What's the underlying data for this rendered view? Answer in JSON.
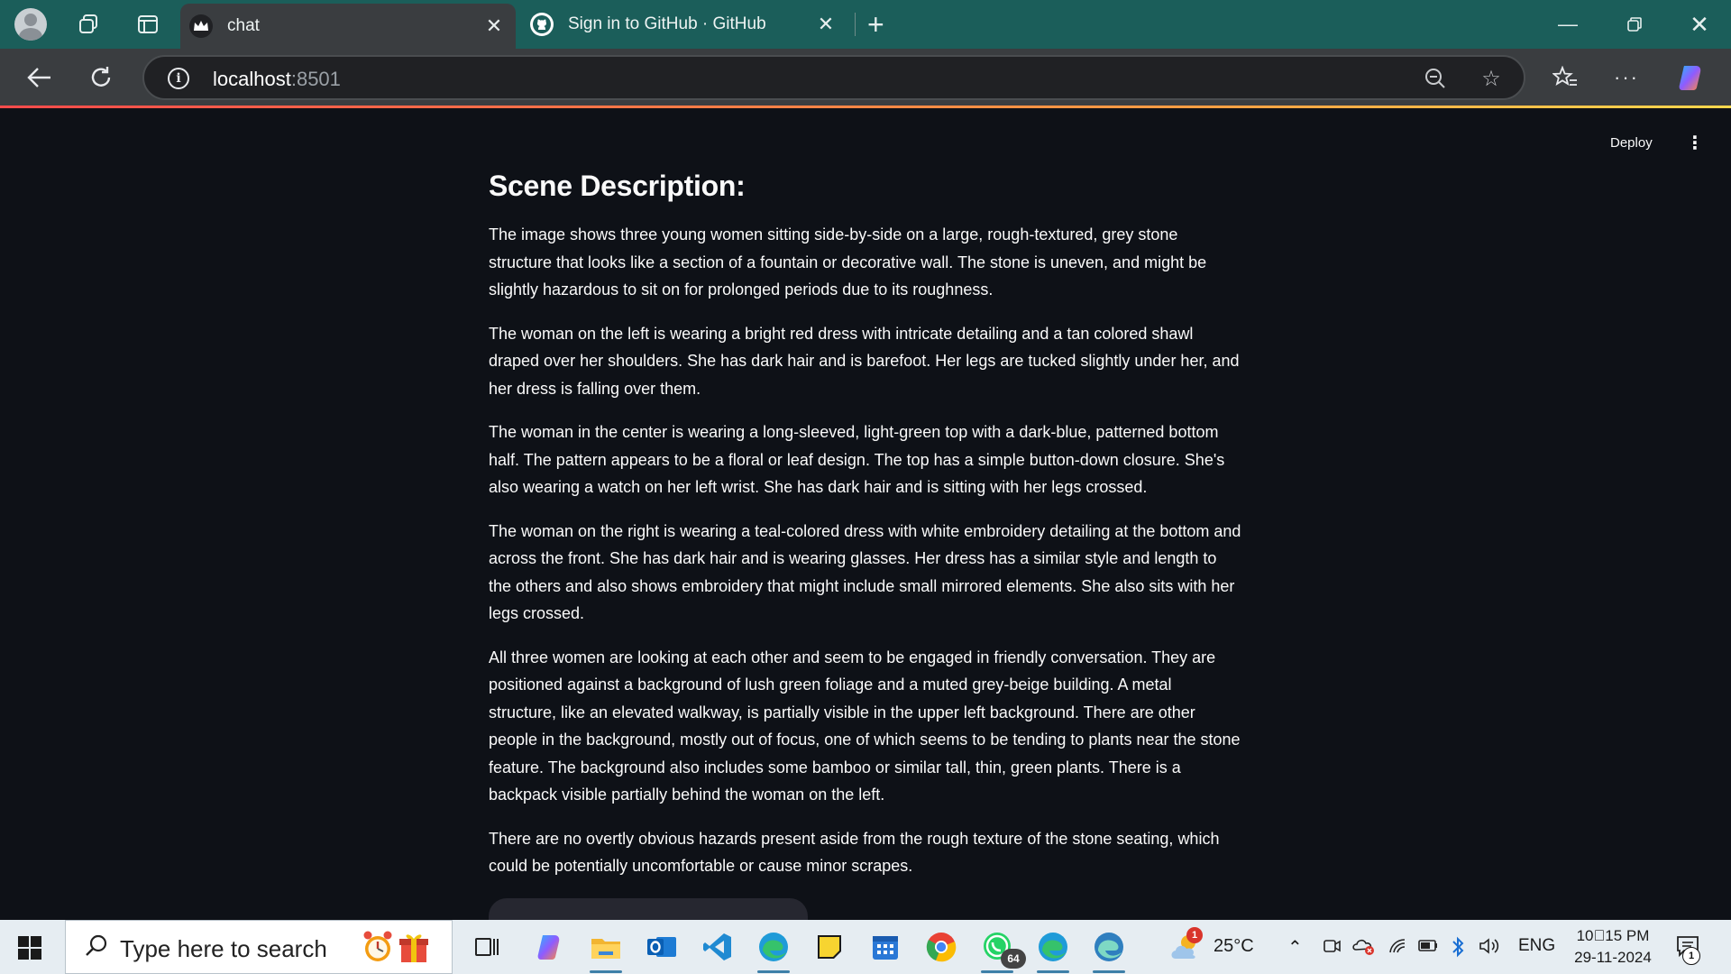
{
  "browser": {
    "tabs": [
      {
        "title": "chat",
        "active": true
      },
      {
        "title": "Sign in to GitHub · GitHub",
        "active": false
      }
    ],
    "address": {
      "host": "localhost",
      "port": ":8501"
    }
  },
  "app": {
    "deploy_label": "Deploy",
    "heading": "Scene Description:",
    "paragraphs": [
      "The image shows three young women sitting side-by-side on a large, rough-textured, grey stone structure that looks like a section of a fountain or decorative wall. The stone is uneven, and might be slightly hazardous to sit on for prolonged periods due to its roughness.",
      "The woman on the left is wearing a bright red dress with intricate detailing and a tan colored shawl draped over her shoulders. She has dark hair and is barefoot. Her legs are tucked slightly under her, and her dress is falling over them.",
      "The woman in the center is wearing a long-sleeved, light-green top with a dark-blue, patterned bottom half. The pattern appears to be a floral or leaf design. The top has a simple button-down closure. She's also wearing a watch on her left wrist. She has dark hair and is sitting with her legs crossed.",
      "The woman on the right is wearing a teal-colored dress with white embroidery detailing at the bottom and across the front. She has dark hair and is wearing glasses. Her dress has a similar style and length to the others and also shows embroidery that might include small mirrored elements. She also sits with her legs crossed.",
      "All three women are looking at each other and seem to be engaged in friendly conversation. They are positioned against a background of lush green foliage and a muted grey-beige building. A metal structure, like an elevated walkway, is partially visible in the upper left background. There are other people in the background, mostly out of focus, one of which seems to be tending to plants near the stone feature. The background also includes some bamboo or similar tall, thin, green plants. There is a backpack visible partially behind the woman on the left.",
      "There are no overtly obvious hazards present aside from the rough texture of the stone seating, which could be potentially uncomfortable or cause minor scrapes."
    ]
  },
  "taskbar": {
    "search_placeholder": "Type here to search",
    "whatsapp_badge": "64",
    "weather_badge": "1",
    "temperature": "25°C",
    "language": "ENG",
    "time": "10\u000015 PM",
    "date": "29-11-2024",
    "notification_count": "1"
  },
  "colors": {
    "titlebar": "#1b5e5a",
    "toolbar": "#3a3d40",
    "app_background": "#0e1117",
    "taskbar": "#e6edf2",
    "accent": "#ff4b4b"
  }
}
